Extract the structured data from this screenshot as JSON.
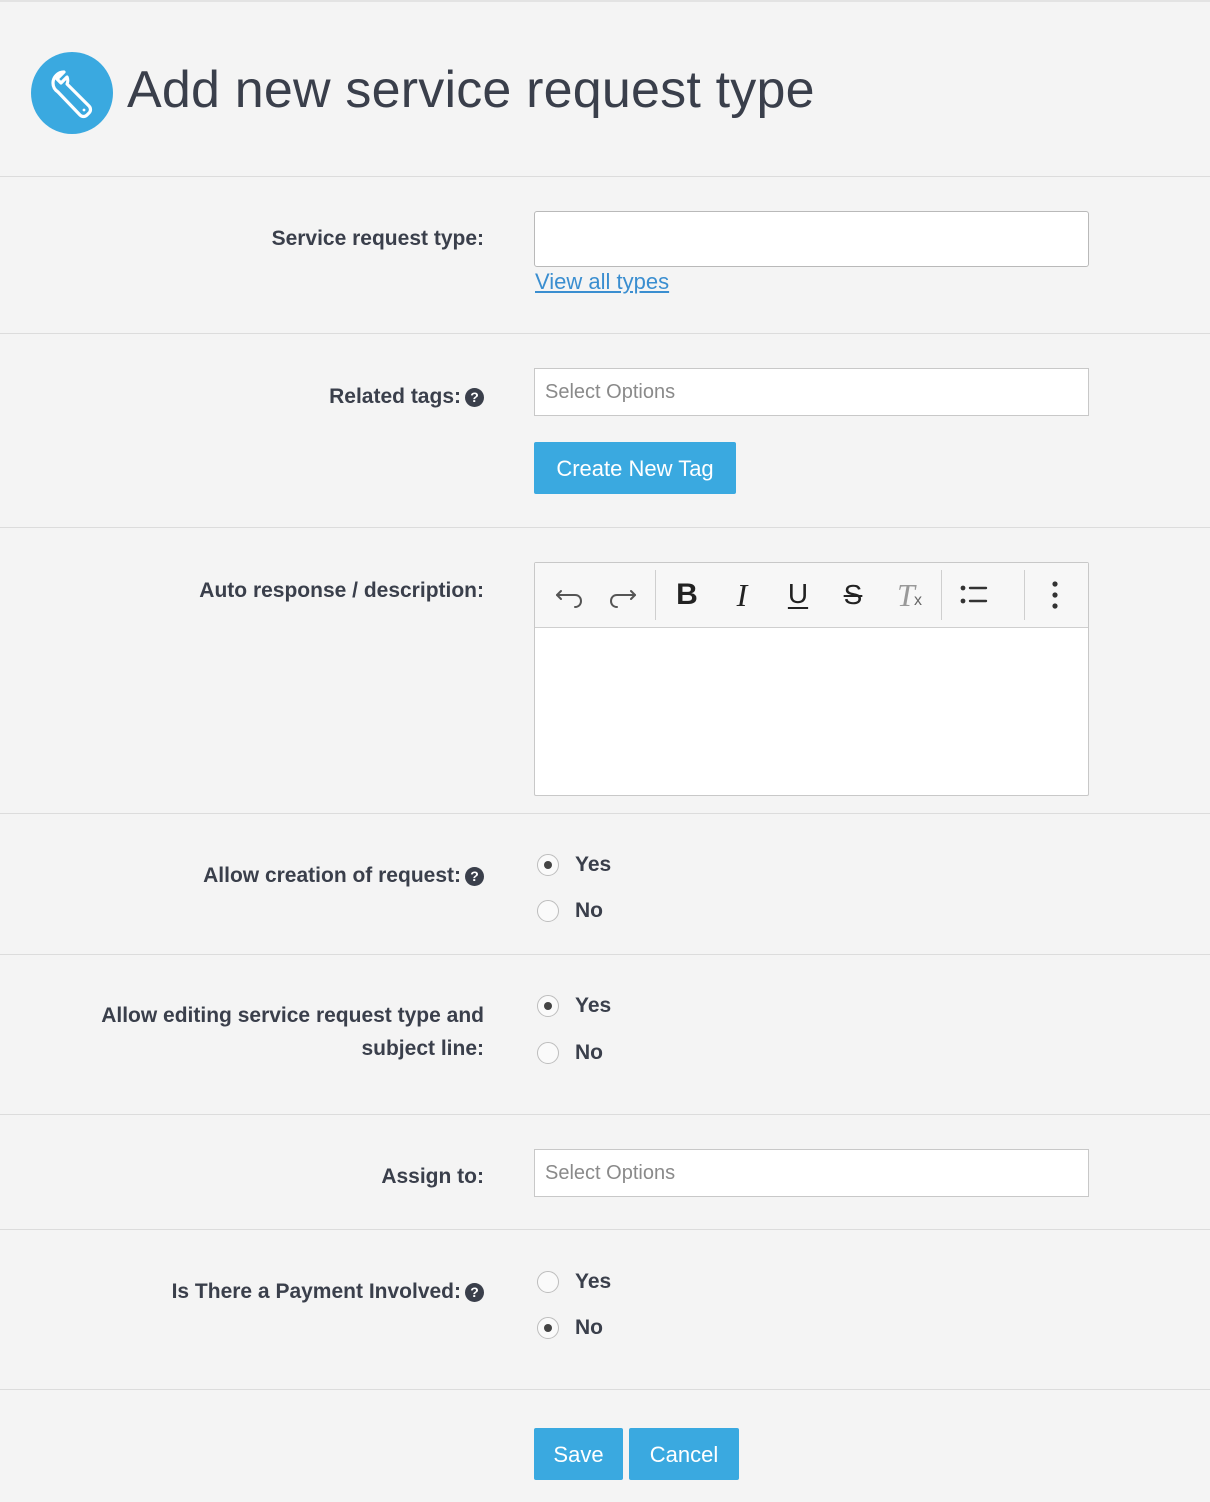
{
  "page": {
    "title": "Add new service request type",
    "logo_icon": "wrench-icon",
    "accent_color": "#3aa9e0"
  },
  "form": {
    "service_request_type": {
      "label": "Service request type:",
      "value": "",
      "link_text": "View all types"
    },
    "related_tags": {
      "label": "Related tags:",
      "placeholder": "Select Options",
      "create_button": "Create New Tag"
    },
    "auto_response": {
      "label": "Auto response / description:",
      "toolbar": [
        "undo-icon",
        "redo-icon",
        "bold-icon",
        "italic-icon",
        "underline-icon",
        "strikethrough-icon",
        "clear-format-icon",
        "bullet-list-icon",
        "more-options-icon"
      ],
      "bold_glyph": "B",
      "italic_glyph": "I",
      "underline_glyph": "U",
      "strike_glyph": "S",
      "clear_glyph": "T",
      "clear_sub_glyph": "x",
      "content": ""
    },
    "allow_creation": {
      "label_line1": "Allow creation of request:",
      "options": [
        {
          "label": "Yes",
          "checked": true
        },
        {
          "label": "No",
          "checked": false
        }
      ]
    },
    "allow_editing": {
      "label_line1": "Allow editing service request type and",
      "label_line2": "subject line:",
      "options": [
        {
          "label": "Yes",
          "checked": true
        },
        {
          "label": "No",
          "checked": false
        }
      ]
    },
    "assign_to": {
      "label": "Assign to:",
      "placeholder": "Select Options"
    },
    "payment": {
      "label": "Is There a Payment Involved:",
      "options": [
        {
          "label": "Yes",
          "checked": false
        },
        {
          "label": "No",
          "checked": true
        }
      ]
    }
  },
  "actions": {
    "save": "Save",
    "cancel": "Cancel"
  },
  "help_glyph": "?"
}
